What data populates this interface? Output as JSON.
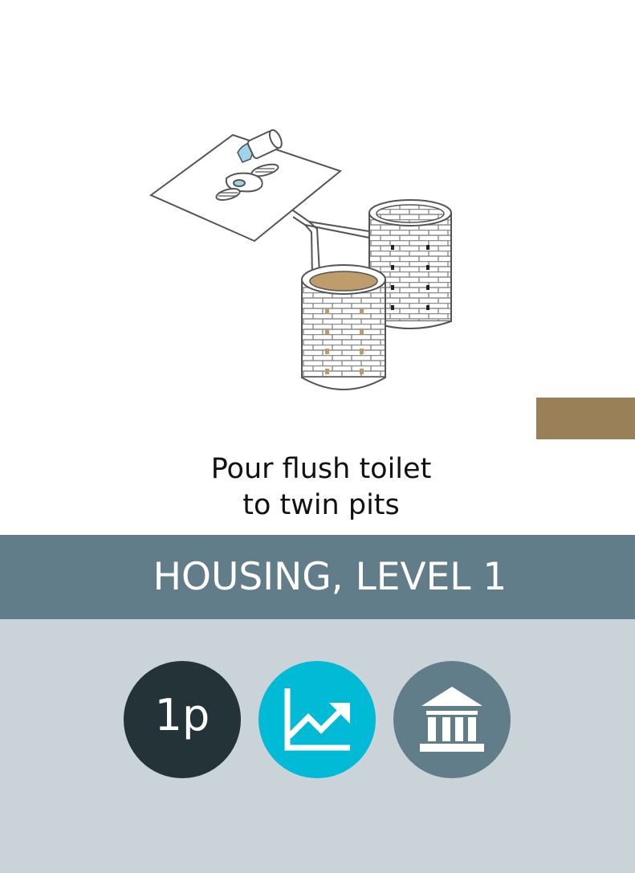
{
  "card": {
    "caption_line1": "Pour flush toilet",
    "caption_line2": "to twin pits",
    "category": "HOUSING, LEVEL 1",
    "colors": {
      "accent": "#9a8059",
      "band": "#627d8a",
      "lower": "#c9d3d8",
      "badge_dark": "#233338",
      "badge_cyan": "#00bad6"
    }
  },
  "badges": {
    "cost": {
      "label": "1p",
      "icon": "text"
    },
    "growth": {
      "icon": "chart-trending-up-icon"
    },
    "institution": {
      "icon": "bank-building-icon"
    }
  }
}
